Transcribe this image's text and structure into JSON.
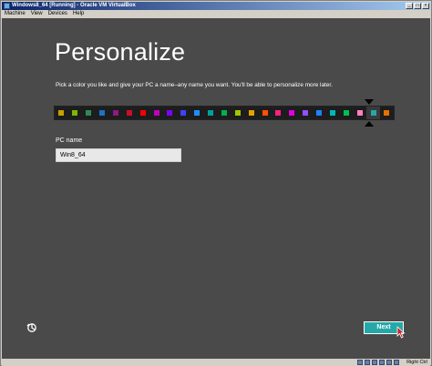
{
  "window": {
    "title": "Windows8_64 [Running] - Oracle VM VirtualBox",
    "buttons": {
      "minimize": "_",
      "maximize": "□",
      "close": "×"
    }
  },
  "menu": [
    "Machine",
    "View",
    "Devices",
    "Help"
  ],
  "setup": {
    "heading": "Personalize",
    "instruction": "Pick a color you like and give your PC a name–any name you want. You'll be able to personalize more later.",
    "palette": [
      "#c8a000",
      "#7cb800",
      "#2e8b57",
      "#1a73c8",
      "#8b1a8b",
      "#c8102e",
      "#ff0000",
      "#c000c0",
      "#8000ff",
      "#4040ff",
      "#1e90ff",
      "#00a0a0",
      "#00b050",
      "#a0c800",
      "#e8a000",
      "#ff5000",
      "#ff2080",
      "#e000e0",
      "#9050ff",
      "#2080ff",
      "#00b8b8",
      "#00c050",
      "#ff80c0",
      "#26a8a8",
      "#e87000"
    ],
    "selected_color_index": 23,
    "pc_name_label": "PC name",
    "pc_name_value": "Win8_64",
    "next_label": "Next"
  },
  "status": {
    "host_key": "Right Ctrl"
  },
  "icons": {
    "accessibility": "ease-of-access-icon",
    "cursor": "mouse-pointer-icon"
  }
}
